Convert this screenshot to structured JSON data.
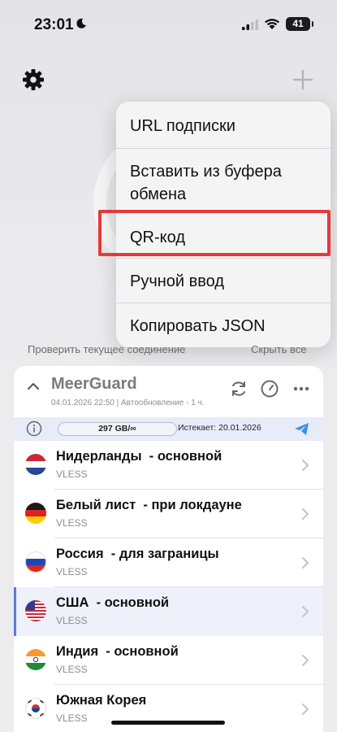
{
  "status": {
    "time": "23:01",
    "battery": "41"
  },
  "menu": {
    "items": [
      {
        "label": "URL подписки"
      },
      {
        "label": "Вставить из буфера обмена"
      },
      {
        "label": "QR-код"
      },
      {
        "label": "Ручной ввод"
      },
      {
        "label": "Копировать JSON"
      }
    ],
    "highlighted": "QR-код"
  },
  "links": {
    "check_connection": "Проверить текущее соединение",
    "hide_all": "Скрыть все"
  },
  "subscription": {
    "title": "MeerGuard",
    "meta": "04.01.2026 22:50 | Автообновление - 1 ч.",
    "traffic": "297 GB/∞",
    "expires": "Истекает: 20.01.2026"
  },
  "servers": [
    {
      "name": "Нидерланды  - основной",
      "protocol": "VLESS",
      "flag": "nl",
      "selected": false
    },
    {
      "name": "Белый лист  - при локдауне",
      "protocol": "VLESS",
      "flag": "de",
      "selected": false
    },
    {
      "name": "Россия  - для заграницы",
      "protocol": "VLESS",
      "flag": "ru",
      "selected": false
    },
    {
      "name": "США  - основной",
      "protocol": "VLESS",
      "flag": "us",
      "selected": true
    },
    {
      "name": "Индия  - основной",
      "protocol": "VLESS",
      "flag": "in",
      "selected": false
    },
    {
      "name": "Южная Корея",
      "protocol": "VLESS",
      "flag": "kr",
      "selected": false
    }
  ],
  "colors": {
    "accent": "#5b7be0",
    "highlight_border": "#e5383b",
    "info_bar": "#e8ecf8"
  }
}
